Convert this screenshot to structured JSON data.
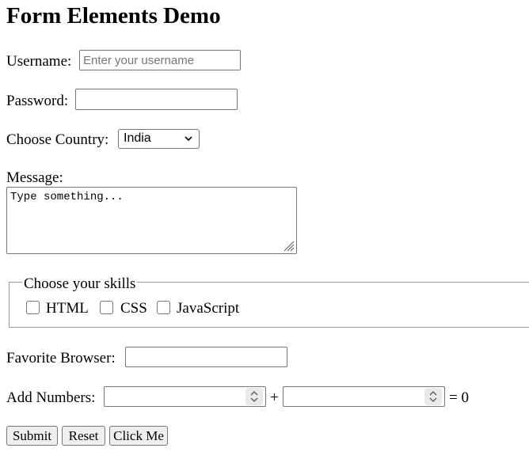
{
  "page": {
    "title": "Form Elements Demo"
  },
  "username": {
    "label": "Username:",
    "placeholder": "Enter your username",
    "value": ""
  },
  "password": {
    "label": "Password:",
    "value": ""
  },
  "country": {
    "label": "Choose Country:",
    "selected": "India"
  },
  "message": {
    "label": "Message:",
    "placeholder": "Type something...",
    "value": ""
  },
  "skills": {
    "legend": "Choose your skills",
    "options": [
      {
        "label": "HTML",
        "checked": false
      },
      {
        "label": "CSS",
        "checked": false
      },
      {
        "label": "JavaScript",
        "checked": false
      }
    ]
  },
  "browser": {
    "label": "Favorite Browser:",
    "value": ""
  },
  "add_numbers": {
    "label": "Add Numbers:",
    "plus": "+",
    "result": "= 0"
  },
  "buttons": {
    "submit": "Submit",
    "reset": "Reset",
    "click_me": "Click Me"
  },
  "icons": {
    "select_arrow": "chevron-down-icon",
    "resize": "resize-grip-icon",
    "spinner": "spinner-arrows-icon"
  }
}
